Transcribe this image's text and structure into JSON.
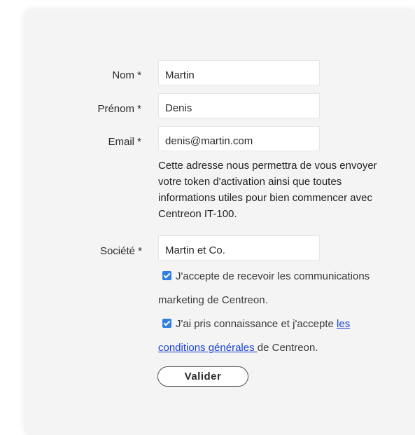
{
  "form": {
    "fields": {
      "nom": {
        "label": "Nom *",
        "value": "Martin"
      },
      "prenom": {
        "label": "Prénom *",
        "value": "Denis"
      },
      "email": {
        "label": "Email *",
        "value": "denis@martin.com"
      },
      "societe": {
        "label": "Société *",
        "value": "Martin et Co."
      }
    },
    "email_help": "Cette adresse nous permettra de vous envoyer votre token d'activation ainsi que toutes informations utiles pour bien commencer avec Centreon IT-100.",
    "marketing_consent": {
      "checked": true,
      "text": "J'accepte de recevoir les communications marketing de Centreon."
    },
    "terms_consent": {
      "checked": true,
      "text_before": "J'ai pris connaissance et j'accepte ",
      "link_text": "les conditions générales ",
      "text_after": "de Centreon."
    },
    "submit_label": "Valider"
  },
  "colors": {
    "card_background": "#f4f4f4",
    "checkbox": "#2f7de1",
    "link": "#1a44d6"
  }
}
